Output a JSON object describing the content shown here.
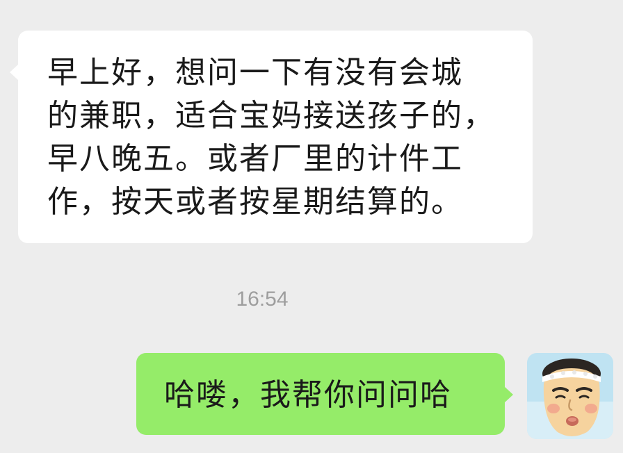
{
  "messages": [
    {
      "direction": "incoming",
      "lines": [
        "早上好，想问一下有没有会城",
        "的兼职，适合宝妈接送孩子的，",
        "早八晚五。或者厂里的计件工",
        "作，按天或者按星期结算的。"
      ]
    },
    {
      "direction": "outgoing",
      "text": "哈喽，我帮你问问哈"
    }
  ],
  "timestamp": "16:54",
  "colors": {
    "background": "#ededed",
    "incoming_bubble": "#ffffff",
    "outgoing_bubble": "#95ec69",
    "timestamp_text": "#9e9e9e",
    "message_text": "#1a1a1a"
  },
  "avatar": {
    "icon": "cartoon-face-avatar"
  }
}
